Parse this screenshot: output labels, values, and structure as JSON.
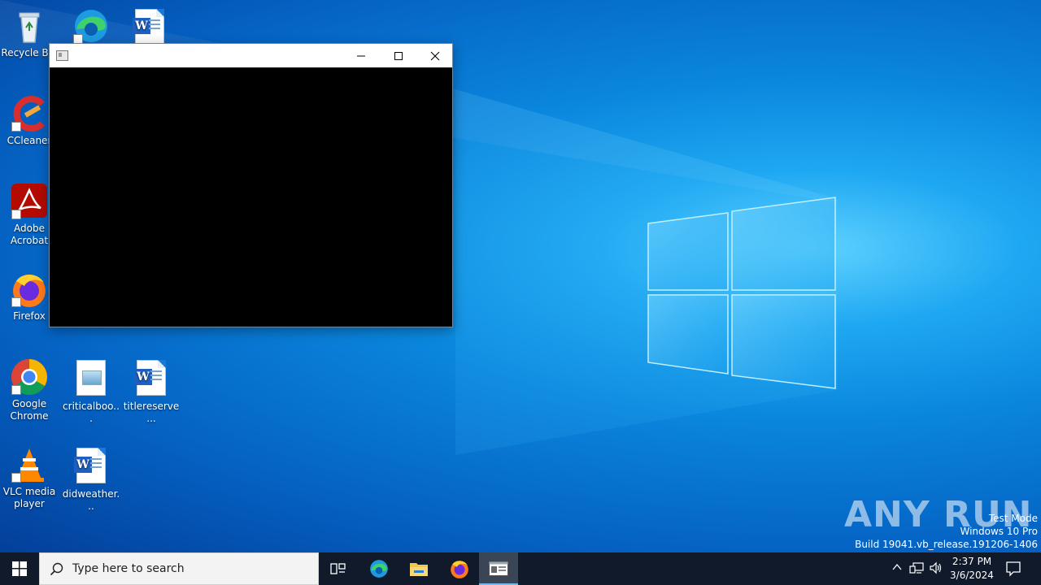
{
  "desktop": {
    "icons": [
      {
        "label": "Recycle Bin",
        "icon": "recycle-bin-icon"
      },
      {
        "label": "",
        "icon": "edge-icon"
      },
      {
        "label": "",
        "icon": "word-doc-icon"
      },
      {
        "label": "CCleaner",
        "icon": "ccleaner-icon"
      },
      {
        "label": "Adobe Acrobat",
        "icon": "acrobat-icon"
      },
      {
        "label": "Firefox",
        "icon": "firefox-icon"
      },
      {
        "label": "Google Chrome",
        "icon": "chrome-icon"
      },
      {
        "label": "criticalboo...",
        "icon": "image-file-icon"
      },
      {
        "label": "titlereserve...",
        "icon": "word-doc-icon"
      },
      {
        "label": "VLC media player",
        "icon": "vlc-icon"
      },
      {
        "label": "didweather...",
        "icon": "word-doc-icon"
      }
    ]
  },
  "window": {
    "title": "",
    "minimize_glyph": "—",
    "maximize_glyph": "☐",
    "close_glyph": "✕"
  },
  "watermark": {
    "brand": "ANY RUN",
    "line1": "Test Mode",
    "line2": "Windows 10 Pro",
    "line3": "Build 19041.vb_release.191206-1406"
  },
  "taskbar": {
    "search_placeholder": "Type here to search",
    "time": "2:37 PM",
    "date": "3/6/2024"
  },
  "colors": {
    "taskbar_bg": "#101a2a",
    "accent": "#76b9ed",
    "window_client": "#000000"
  }
}
